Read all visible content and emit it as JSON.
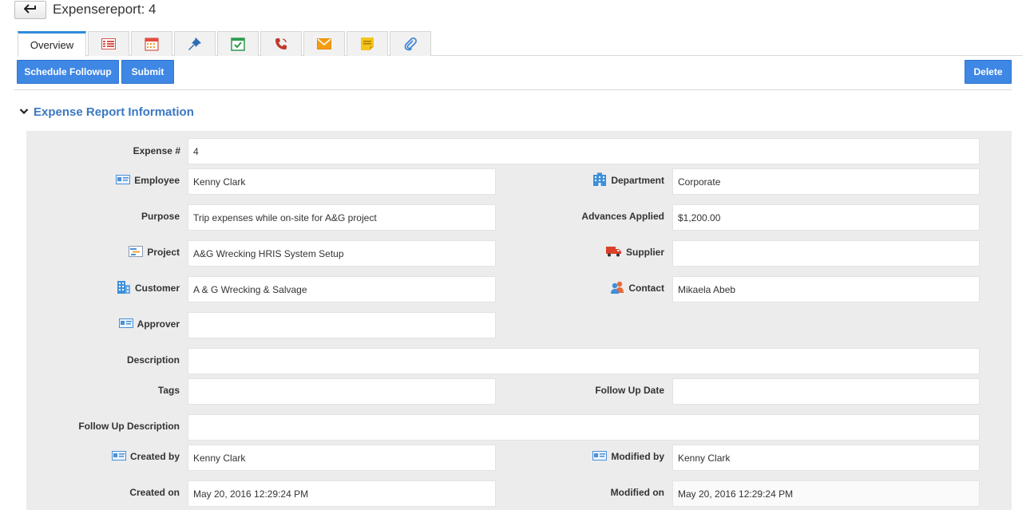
{
  "header": {
    "title": "Expensereport: 4"
  },
  "tabs": [
    {
      "label": "Overview",
      "icon": "overview"
    },
    {
      "label": "",
      "icon": "list-icon"
    },
    {
      "label": "",
      "icon": "calendar-grid-icon"
    },
    {
      "label": "",
      "icon": "pin-icon"
    },
    {
      "label": "",
      "icon": "calendar-check-icon"
    },
    {
      "label": "",
      "icon": "phone-icon"
    },
    {
      "label": "",
      "icon": "mail-icon"
    },
    {
      "label": "",
      "icon": "note-icon"
    },
    {
      "label": "",
      "icon": "paperclip-icon"
    }
  ],
  "actions": {
    "schedule_followup": "Schedule Followup",
    "submit": "Submit",
    "delete": "Delete"
  },
  "section": {
    "title": "Expense Report Information"
  },
  "fields": {
    "expense_no": {
      "label": "Expense #",
      "value": "4"
    },
    "employee": {
      "label": "Employee",
      "value": "Kenny Clark"
    },
    "department": {
      "label": "Department",
      "value": "Corporate"
    },
    "purpose": {
      "label": "Purpose",
      "value": "Trip expenses while on-site for A&G project"
    },
    "advances_applied": {
      "label": "Advances Applied",
      "value": "$1,200.00"
    },
    "project": {
      "label": "Project",
      "value": "A&G Wrecking HRIS System Setup"
    },
    "supplier": {
      "label": "Supplier",
      "value": ""
    },
    "customer": {
      "label": "Customer",
      "value": "A & G Wrecking & Salvage"
    },
    "contact": {
      "label": "Contact",
      "value": "Mikaela Abeb"
    },
    "approver": {
      "label": "Approver",
      "value": ""
    },
    "description": {
      "label": "Description",
      "value": ""
    },
    "tags": {
      "label": "Tags",
      "value": ""
    },
    "follow_up_date": {
      "label": "Follow Up Date",
      "value": ""
    },
    "follow_up_description": {
      "label": "Follow Up Description",
      "value": ""
    },
    "created_by": {
      "label": "Created by",
      "value": "Kenny Clark"
    },
    "modified_by": {
      "label": "Modified by",
      "value": "Kenny Clark"
    },
    "created_on": {
      "label": "Created on",
      "value": "May 20, 2016 12:29:24 PM"
    },
    "modified_on": {
      "label": "Modified on",
      "value": "May 20, 2016 12:29:24 PM"
    }
  },
  "colors": {
    "accent": "#3f87e5",
    "section_title": "#3b78c4",
    "panel_bg": "#ececec"
  }
}
